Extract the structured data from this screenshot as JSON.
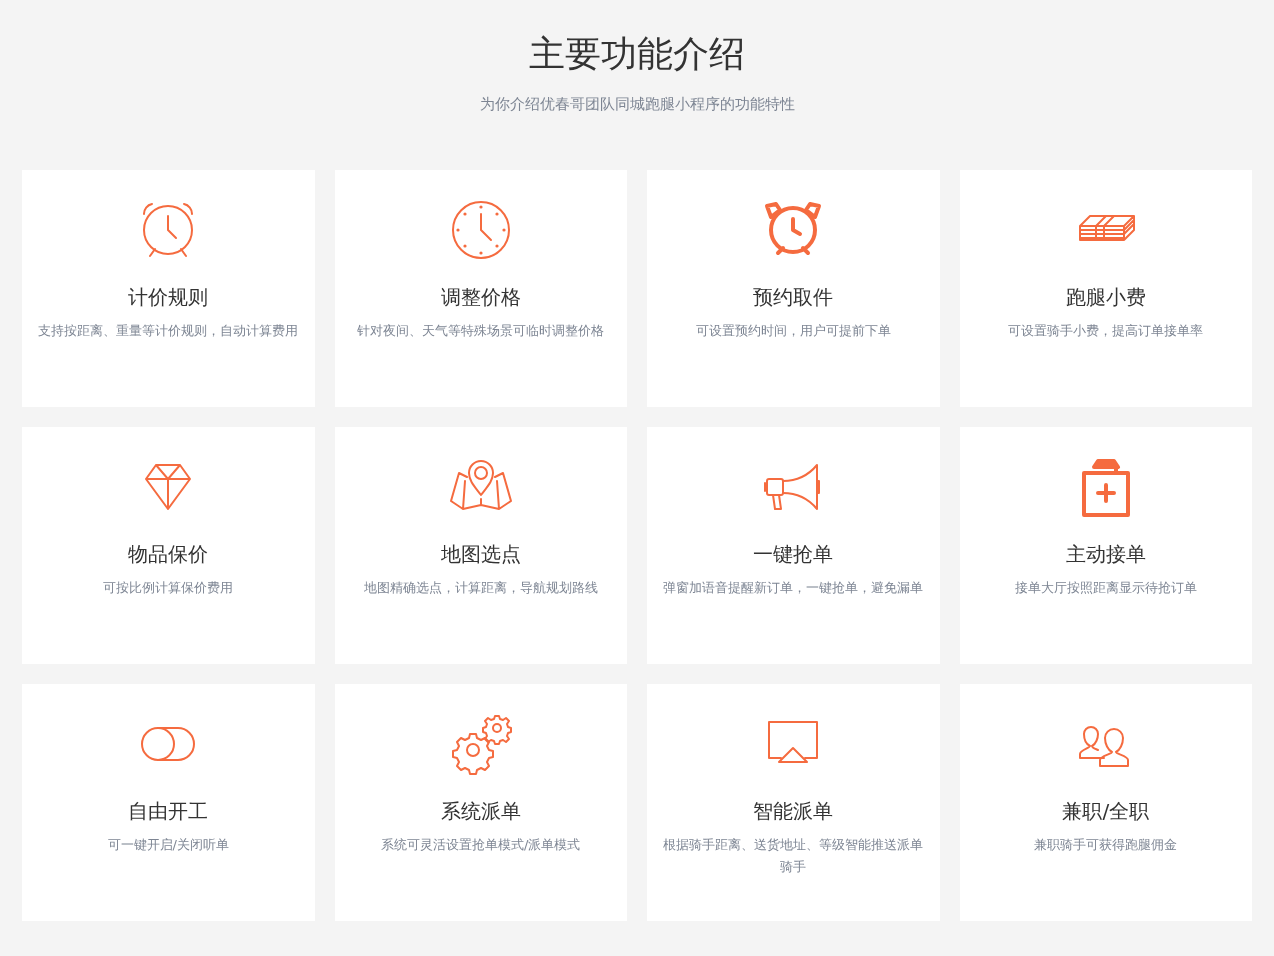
{
  "header": {
    "title": "主要功能介绍",
    "subtitle": "为你介绍优春哥团队同城跑腿小程序的功能特性"
  },
  "features": [
    {
      "kind": "alarm",
      "title": "计价规则",
      "description": "支持按距离、重量等计价规则，自动计算费用"
    },
    {
      "kind": "clock",
      "title": "调整价格",
      "description": "针对夜间、天气等特殊场景可临时调整价格"
    },
    {
      "kind": "alarm-bold",
      "title": "预约取件",
      "description": "可设置预约时间，用户可提前下单"
    },
    {
      "kind": "money",
      "title": "跑腿小费",
      "description": "可设置骑手小费，提高订单接单率"
    },
    {
      "kind": "diamond",
      "title": "物品保价",
      "description": "可按比例计算保价费用"
    },
    {
      "kind": "map",
      "title": "地图选点",
      "description": "地图精确选点，计算距离，导航规划路线"
    },
    {
      "kind": "megaphone",
      "title": "一键抢单",
      "description": "弹窗加语音提醒新订单，一键抢单，避免漏单"
    },
    {
      "kind": "clipboard",
      "title": "主动接单",
      "description": "接单大厅按照距离显示待抢订单"
    },
    {
      "kind": "toggle",
      "title": "自由开工",
      "description": "可一键开启/关闭听单"
    },
    {
      "kind": "gears",
      "title": "系统派单",
      "description": "系统可灵活设置抢单模式/派单模式"
    },
    {
      "kind": "screen",
      "title": "智能派单",
      "description": "根据骑手距离、送货地址、等级智能推送派单骑手"
    },
    {
      "kind": "users",
      "title": "兼职/全职",
      "description": "兼职骑手可获得跑腿佣金"
    }
  ]
}
